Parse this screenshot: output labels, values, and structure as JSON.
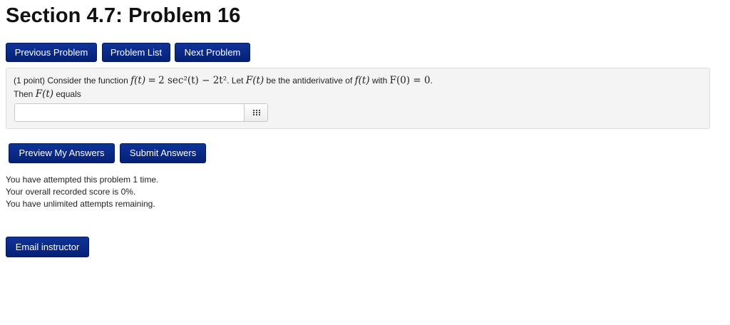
{
  "page": {
    "title": "Section 4.7: Problem 16"
  },
  "nav": {
    "previous_label": "Previous Problem",
    "list_label": "Problem List",
    "next_label": "Next Problem"
  },
  "problem": {
    "points": "(1 point)",
    "line1_pre": "Consider the function",
    "f_of_t": "f(t)",
    "equals_sign": "=",
    "expression": "2 sec²(t) − 2t²",
    "line1_mid": ". Let",
    "F_of_t": "F(t)",
    "line1_mid2": "be the antiderivative of",
    "line1_f": "f(t)",
    "line1_with": "with",
    "condition": "F(0) = 0",
    "period": ".",
    "line2_pre": "Then",
    "line2_F": "F(t)",
    "line2_post": "equals",
    "answer_value": "",
    "answer_placeholder": "",
    "palette_icon": "grid-icon"
  },
  "actions": {
    "preview_label": "Preview My Answers",
    "submit_label": "Submit Answers"
  },
  "status": {
    "line1": "You have attempted this problem 1 time.",
    "line2": "Your overall recorded score is 0%.",
    "line3": "You have unlimited attempts remaining."
  },
  "footer": {
    "email_label": "Email instructor"
  },
  "colors": {
    "button_bg": "#0a2a8a",
    "problem_bg": "#f4f4f4"
  }
}
